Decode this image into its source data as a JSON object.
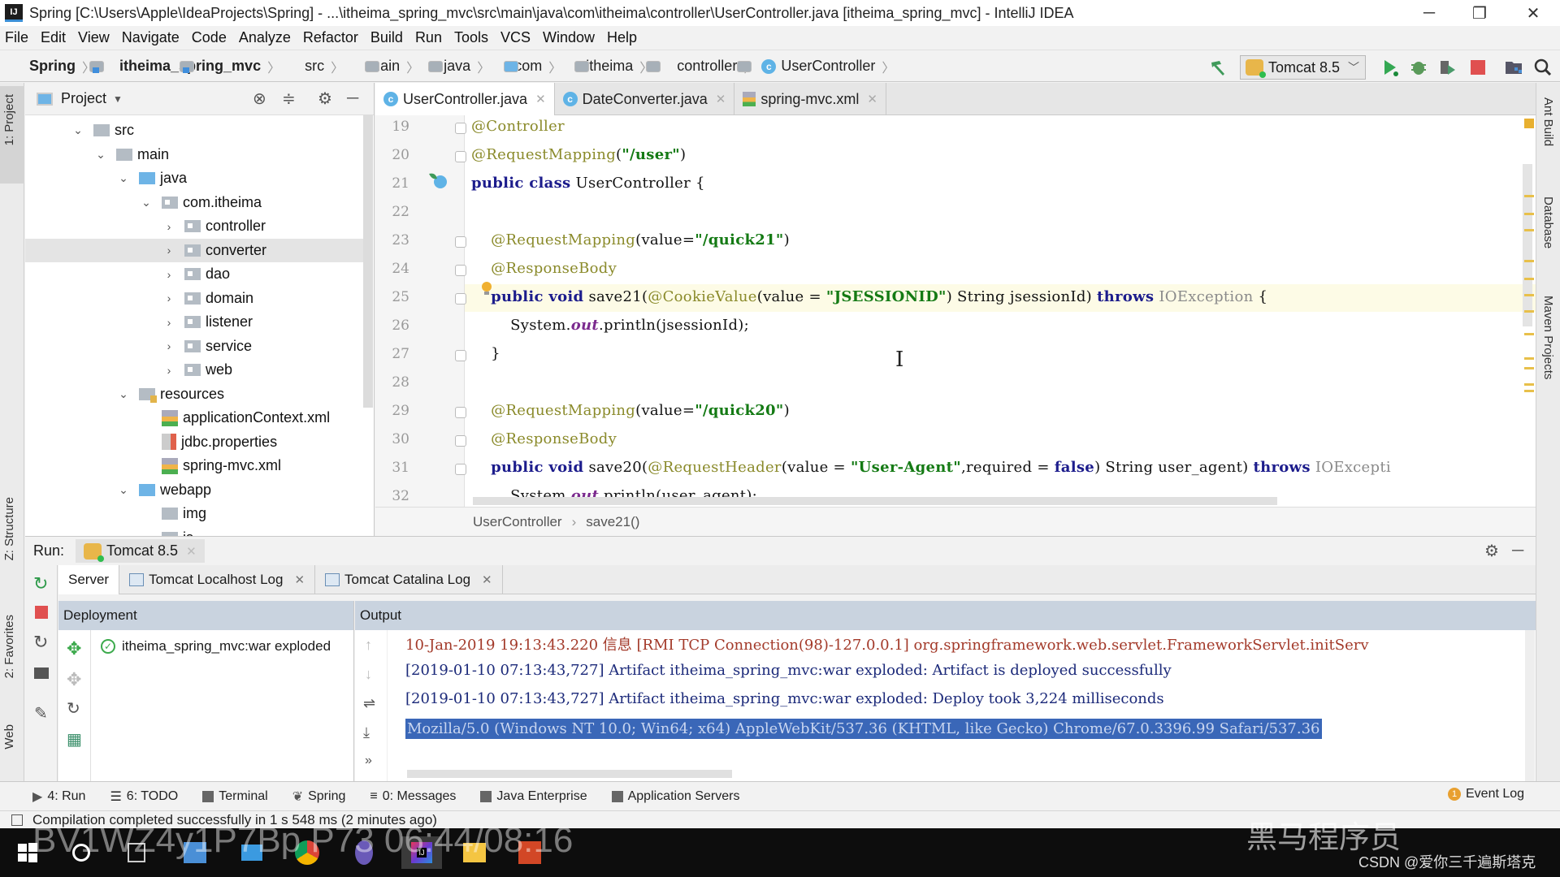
{
  "window": {
    "title": "Spring [C:\\Users\\Apple\\IdeaProjects\\Spring] - ...\\itheima_spring_mvc\\src\\main\\java\\com\\itheima\\controller\\UserController.java [itheima_spring_mvc] - IntelliJ IDEA",
    "app_icon": "IJ",
    "controls": {
      "minimize": "─",
      "restore": "❐",
      "close": "✕"
    }
  },
  "menu": [
    "File",
    "Edit",
    "View",
    "Navigate",
    "Code",
    "Analyze",
    "Refactor",
    "Build",
    "Run",
    "Tools",
    "VCS",
    "Window",
    "Help"
  ],
  "breadcrumbs": [
    {
      "label": "Spring",
      "bold": true,
      "icon": "module-folder-icon"
    },
    {
      "label": "itheima_spring_mvc",
      "bold": true,
      "icon": "module-folder-icon"
    },
    {
      "label": "src",
      "icon": "folder-icon"
    },
    {
      "label": "main",
      "icon": "folder-icon"
    },
    {
      "label": "java",
      "icon": "source-folder-icon"
    },
    {
      "label": "com",
      "icon": "package-icon"
    },
    {
      "label": "itheima",
      "icon": "package-icon"
    },
    {
      "label": "controller",
      "icon": "package-icon"
    },
    {
      "label": "UserController",
      "icon": "class-icon"
    }
  ],
  "run_config": {
    "label": "Tomcat 8.5",
    "icon": "tomcat-icon"
  },
  "toolbar_icons": [
    "build-hammer-icon",
    "run-icon",
    "debug-icon",
    "coverage-icon",
    "stop-icon",
    "project-structure-icon",
    "search-icon"
  ],
  "left_strip": {
    "project": "1: Project",
    "structure": "Z: Structure",
    "favorites": "2: Favorites",
    "web": "Web"
  },
  "right_strip": {
    "ant": "Ant Build",
    "database": "Database",
    "maven": "Maven Projects"
  },
  "project_panel": {
    "title": "Project",
    "tree": [
      {
        "label": "src",
        "depth": 0,
        "expanded": true,
        "icon": "folder"
      },
      {
        "label": "main",
        "depth": 1,
        "expanded": true,
        "icon": "folder"
      },
      {
        "label": "java",
        "depth": 2,
        "expanded": true,
        "icon": "source"
      },
      {
        "label": "com.itheima",
        "depth": 3,
        "expanded": true,
        "icon": "package"
      },
      {
        "label": "controller",
        "depth": 4,
        "expanded": false,
        "icon": "package"
      },
      {
        "label": "converter",
        "depth": 4,
        "expanded": false,
        "icon": "package",
        "selected": true
      },
      {
        "label": "dao",
        "depth": 4,
        "expanded": false,
        "icon": "package"
      },
      {
        "label": "domain",
        "depth": 4,
        "expanded": false,
        "icon": "package"
      },
      {
        "label": "listener",
        "depth": 4,
        "expanded": false,
        "icon": "package"
      },
      {
        "label": "service",
        "depth": 4,
        "expanded": false,
        "icon": "package"
      },
      {
        "label": "web",
        "depth": 4,
        "expanded": false,
        "icon": "package"
      },
      {
        "label": "resources",
        "depth": 2,
        "expanded": true,
        "icon": "resources"
      },
      {
        "label": "applicationContext.xml",
        "depth": 3,
        "icon": "xml"
      },
      {
        "label": "jdbc.properties",
        "depth": 3,
        "icon": "properties"
      },
      {
        "label": "spring-mvc.xml",
        "depth": 3,
        "icon": "xml"
      },
      {
        "label": "webapp",
        "depth": 2,
        "expanded": true,
        "icon": "web"
      },
      {
        "label": "img",
        "depth": 3,
        "icon": "folder"
      },
      {
        "label": "js",
        "depth": 3,
        "expanded": false,
        "icon": "folder"
      }
    ]
  },
  "editor_tabs": [
    {
      "label": "UserController.java",
      "active": true,
      "icon": "class-icon"
    },
    {
      "label": "DateConverter.java",
      "active": false,
      "icon": "class-icon"
    },
    {
      "label": "spring-mvc.xml",
      "active": false,
      "icon": "xml-icon"
    }
  ],
  "editor": {
    "lines": [
      {
        "n": "19",
        "html": "<span class=\"ann\">@Controller</span>"
      },
      {
        "n": "20",
        "html": "<span class=\"ann\">@RequestMapping</span>(<span class=\"str\">\"/user\"</span>)"
      },
      {
        "n": "21",
        "html": "<span class=\"kw\">public class</span> UserController {"
      },
      {
        "n": "22",
        "html": ""
      },
      {
        "n": "23",
        "html": "    <span class=\"ann\">@RequestMapping</span>(value=<span class=\"str\">\"/quick21\"</span>)"
      },
      {
        "n": "24",
        "html": "    <span class=\"ann\">@ResponseBody</span>"
      },
      {
        "n": "25",
        "html": "    <span class=\"kw\">public void</span> save21(<span class=\"ann\">@CookieValue</span>(value = <span class=\"str\">\"JSESSIONID\"</span>) String jsessionId) <span class=\"kw\">throws</span> <span class=\"gr\">IOException</span> {",
        "current": true
      },
      {
        "n": "26",
        "html": "        System.<span class=\"st\">out</span>.println(jsessionId);"
      },
      {
        "n": "27",
        "html": "    }"
      },
      {
        "n": "28",
        "html": ""
      },
      {
        "n": "29",
        "html": "    <span class=\"ann\">@RequestMapping</span>(value=<span class=\"str\">\"/quick20\"</span>)"
      },
      {
        "n": "30",
        "html": "    <span class=\"ann\">@ResponseBody</span>"
      },
      {
        "n": "31",
        "html": "    <span class=\"kw\">public void</span> save20(<span class=\"ann\">@RequestHeader</span>(value = <span class=\"str\">\"User-Agent\"</span>,required = <span class=\"kw\">false</span>) String user_agent) <span class=\"kw\">throws</span> <span class=\"gr\">IOExcepti</span>"
      },
      {
        "n": "32",
        "html": "        System.<span class=\"st\">out</span>.println(user_agent);"
      }
    ],
    "breadcrumb": [
      "UserController",
      "save21()"
    ]
  },
  "run_panel": {
    "label": "Run:",
    "config_tab": "Tomcat 8.5",
    "tabs": [
      {
        "label": "Server",
        "active": true
      },
      {
        "label": "Tomcat Localhost Log",
        "closable": true
      },
      {
        "label": "Tomcat Catalina Log",
        "closable": true
      }
    ],
    "deployment_header": "Deployment",
    "output_header": "Output",
    "deployments": [
      {
        "label": "itheima_spring_mvc:war exploded",
        "status": "deployed"
      }
    ],
    "output_lines": [
      {
        "text": "10-Jan-2019 19:13:43.220 信息 [RMI TCP Connection(98)-127.0.0.1] org.springframework.web.servlet.FrameworkServlet.initServ",
        "style": "red"
      },
      {
        "text": "[2019-01-10 07:13:43,727] Artifact itheima_spring_mvc:war exploded: Artifact is deployed successfully",
        "style": "normal"
      },
      {
        "text": "[2019-01-10 07:13:43,727] Artifact itheima_spring_mvc:war exploded: Deploy took 3,224 milliseconds",
        "style": "normal"
      },
      {
        "text": "Mozilla/5.0 (Windows NT 10.0; Win64; x64) AppleWebKit/537.36 (KHTML, like Gecko) Chrome/67.0.3396.99 Safari/537.36",
        "style": "selected"
      }
    ]
  },
  "bottom_tools": [
    {
      "label": "4: Run",
      "icon": "run-icon"
    },
    {
      "label": "6: TODO",
      "icon": "todo-icon"
    },
    {
      "label": "Terminal",
      "icon": "terminal-icon"
    },
    {
      "label": "Spring",
      "icon": "spring-icon"
    },
    {
      "label": "0: Messages",
      "icon": "messages-icon"
    },
    {
      "label": "Java Enterprise",
      "icon": "java-enterprise-icon"
    },
    {
      "label": "Application Servers",
      "icon": "app-servers-icon"
    }
  ],
  "event_log": {
    "label": "Event Log",
    "count": "1"
  },
  "status": "Compilation completed successfully in 1 s 548 ms (2 minutes ago)",
  "watermarks": {
    "video": "BV1WZ4y1P7Bp P73 06:44/08:16",
    "brand": "黑马程序员",
    "csdn": "CSDN @爱你三千遍斯塔克"
  },
  "taskbar": [
    "windows-start-icon",
    "cortana-icon",
    "task-view-icon",
    "app-icon",
    "network-icon",
    "chrome-icon",
    "app-icon",
    "intellij-icon",
    "file-explorer-icon",
    "powerpoint-icon"
  ],
  "colors": {
    "accent": "#3a67b8",
    "keyword": "#1c1c8c",
    "string": "#147a14",
    "annotation": "#8a8a2a"
  }
}
